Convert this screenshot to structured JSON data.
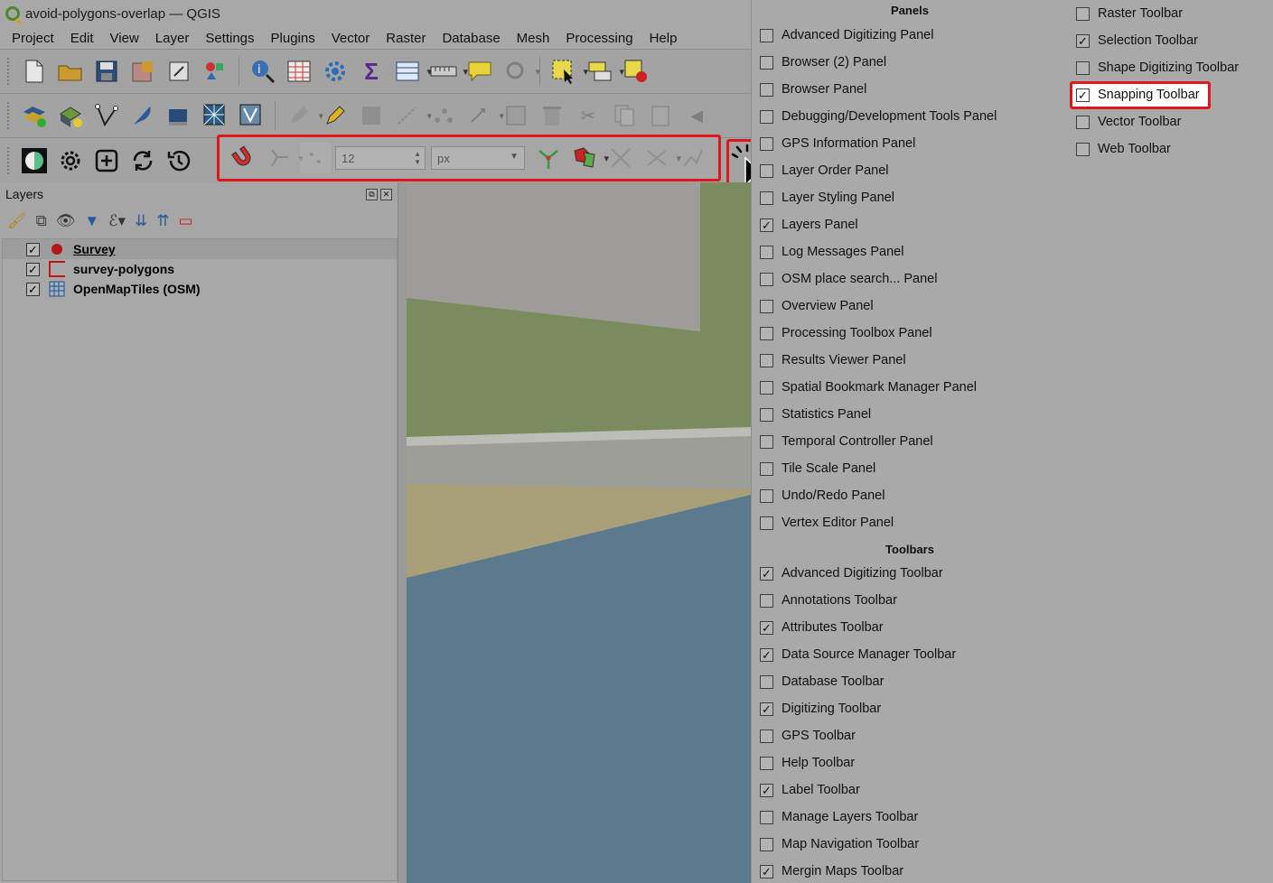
{
  "window": {
    "title": "avoid-polygons-overlap — QGIS"
  },
  "menubar": [
    "Project",
    "Edit",
    "View",
    "Layer",
    "Settings",
    "Plugins",
    "Vector",
    "Raster",
    "Database",
    "Mesh",
    "Processing",
    "Help"
  ],
  "snapping": {
    "tolerance": "12",
    "unit": "px"
  },
  "layers_panel": {
    "title": "Layers",
    "layers": [
      {
        "name": "Survey",
        "checked": true,
        "symbol": "point"
      },
      {
        "name": "survey-polygons",
        "checked": true,
        "symbol": "polygon"
      },
      {
        "name": "OpenMapTiles (OSM)",
        "checked": true,
        "symbol": "raster"
      }
    ]
  },
  "menu": {
    "panels_title": "Panels",
    "toolbars_title": "Toolbars",
    "panels": [
      {
        "label": "Advanced Digitizing Panel",
        "checked": false
      },
      {
        "label": "Browser (2) Panel",
        "checked": false
      },
      {
        "label": "Browser Panel",
        "checked": false
      },
      {
        "label": "Debugging/Development Tools Panel",
        "checked": false
      },
      {
        "label": "GPS Information Panel",
        "checked": false
      },
      {
        "label": "Layer Order Panel",
        "checked": false
      },
      {
        "label": "Layer Styling Panel",
        "checked": false
      },
      {
        "label": "Layers Panel",
        "checked": true
      },
      {
        "label": "Log Messages Panel",
        "checked": false
      },
      {
        "label": "OSM place search... Panel",
        "checked": false
      },
      {
        "label": "Overview Panel",
        "checked": false
      },
      {
        "label": "Processing Toolbox Panel",
        "checked": false
      },
      {
        "label": "Results Viewer Panel",
        "checked": false
      },
      {
        "label": "Spatial Bookmark Manager Panel",
        "checked": false
      },
      {
        "label": "Statistics Panel",
        "checked": false
      },
      {
        "label": "Temporal Controller Panel",
        "checked": false
      },
      {
        "label": "Tile Scale Panel",
        "checked": false
      },
      {
        "label": "Undo/Redo Panel",
        "checked": false
      },
      {
        "label": "Vertex Editor Panel",
        "checked": false
      }
    ],
    "toolbars": [
      {
        "label": "Advanced Digitizing Toolbar",
        "checked": true
      },
      {
        "label": "Annotations Toolbar",
        "checked": false
      },
      {
        "label": "Attributes Toolbar",
        "checked": true
      },
      {
        "label": "Data Source Manager Toolbar",
        "checked": true
      },
      {
        "label": "Database Toolbar",
        "checked": false
      },
      {
        "label": "Digitizing Toolbar",
        "checked": true
      },
      {
        "label": "GPS Toolbar",
        "checked": false
      },
      {
        "label": "Help Toolbar",
        "checked": false
      },
      {
        "label": "Label Toolbar",
        "checked": true
      },
      {
        "label": "Manage Layers Toolbar",
        "checked": false
      },
      {
        "label": "Map Navigation Toolbar",
        "checked": false
      },
      {
        "label": "Mergin Maps Toolbar",
        "checked": true
      }
    ],
    "toolbars_col2": [
      {
        "label": "Raster Toolbar",
        "checked": false
      },
      {
        "label": "Selection Toolbar",
        "checked": true
      },
      {
        "label": "Shape Digitizing Toolbar",
        "checked": false
      },
      {
        "label": "Snapping Toolbar",
        "checked": true
      },
      {
        "label": "Vector Toolbar",
        "checked": false
      },
      {
        "label": "Web Toolbar",
        "checked": false
      }
    ]
  },
  "colors": {
    "highlight": "#e0161f",
    "map_green": "#7a8c5e",
    "map_water": "#5b7a8e",
    "map_sand": "#a9a07a"
  }
}
